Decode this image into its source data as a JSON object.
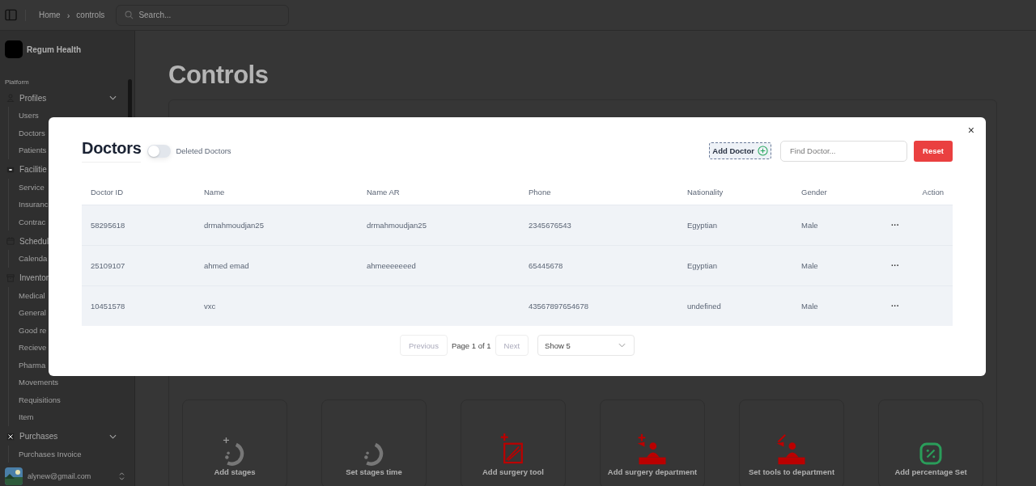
{
  "topbar": {
    "breadcrumb": [
      "Home",
      "controls"
    ],
    "breadcrumb_separator": "›",
    "search": {
      "placeholder": "Search..."
    }
  },
  "sidebar": {
    "brand": "Regum Health",
    "section": "Platform",
    "groups": [
      {
        "label": "Profiles",
        "expanded": true,
        "items": [
          "Users",
          "Doctors",
          "Patients"
        ]
      },
      {
        "label": "Facilitie",
        "items": [
          "Service",
          "Insuranc",
          "Contrac"
        ]
      },
      {
        "label": "Schedul",
        "items": [
          "Calenda"
        ]
      },
      {
        "label": "Inventor",
        "items": [
          "Medical",
          "General",
          "Good re",
          "Recieve",
          "Pharma",
          "Movements",
          "Requisitions",
          "Item"
        ]
      },
      {
        "label": "Purchases",
        "expanded": true,
        "items": [
          "Purchases Invoice"
        ]
      }
    ],
    "user": {
      "email": "alynew@gmail.com"
    }
  },
  "page": {
    "title": "Controls",
    "cards": [
      {
        "kind": "addloader",
        "label": "Add stages"
      },
      {
        "kind": "loader",
        "label": "Set stages time"
      },
      {
        "kind": "tool",
        "label": "Add surgery tool"
      },
      {
        "kind": "surgeon",
        "label": "Add surgery department"
      },
      {
        "kind": "surgeonknife",
        "label": "Set tools to department"
      },
      {
        "kind": "percent",
        "label": "Add percentage Set"
      }
    ]
  },
  "modal": {
    "title": "Doctors",
    "close": "×",
    "toggle": {
      "label": "Deleted Doctors",
      "on": false
    },
    "add_button": {
      "label": "Add Doctor"
    },
    "search": {
      "placeholder": "Find Doctor..."
    },
    "reset_button": "Reset",
    "table": {
      "columns": [
        "Doctor ID",
        "Name",
        "Name AR",
        "Phone",
        "Nationality",
        "Gender",
        "Action"
      ],
      "rows": [
        [
          "58295618",
          "drmahmoudjan25",
          "drmahmoudjan25",
          "2345676543",
          "Egyptian",
          "Male",
          "···"
        ],
        [
          "25109107",
          "ahmed emad",
          "ahmeeeeeeed",
          "65445678",
          "Egyptian",
          "Male",
          "···"
        ],
        [
          "10451578",
          "vxc",
          "",
          "43567897654678",
          "undefined",
          "Male",
          "···"
        ]
      ]
    },
    "pagination": {
      "previous": {
        "label": "Previous",
        "disabled": true
      },
      "page": "Page 1 of 1",
      "next": {
        "label": "Next",
        "disabled": true
      },
      "page_size": "Show 5"
    }
  }
}
